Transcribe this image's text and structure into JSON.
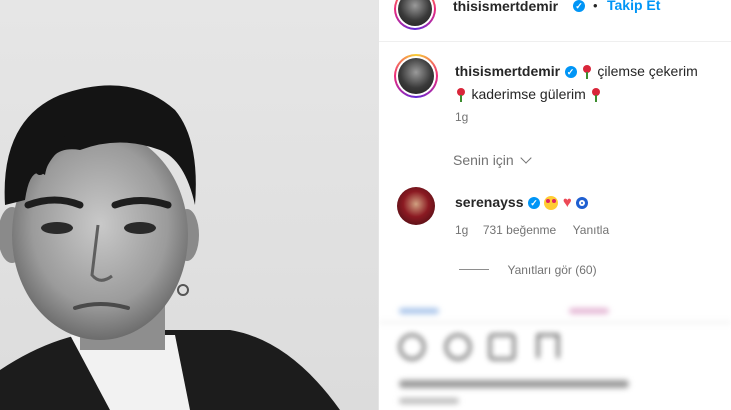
{
  "header": {
    "username": "thisismertdemir",
    "follow_label": "Takip Et",
    "separator": "•"
  },
  "caption": {
    "username": "thisismertdemir",
    "line1": "çilemse çekerim",
    "line2": "kaderimse gülerim",
    "time": "1g"
  },
  "for_you": {
    "label": "Senin için"
  },
  "comment": {
    "username": "serenayss",
    "time": "1g",
    "likes": "731 beğenme",
    "reply_label": "Yanıtla",
    "view_replies_label": "Yanıtları gör (60)"
  },
  "colors": {
    "accent": "#0095f6",
    "heart": "#ed4956"
  }
}
